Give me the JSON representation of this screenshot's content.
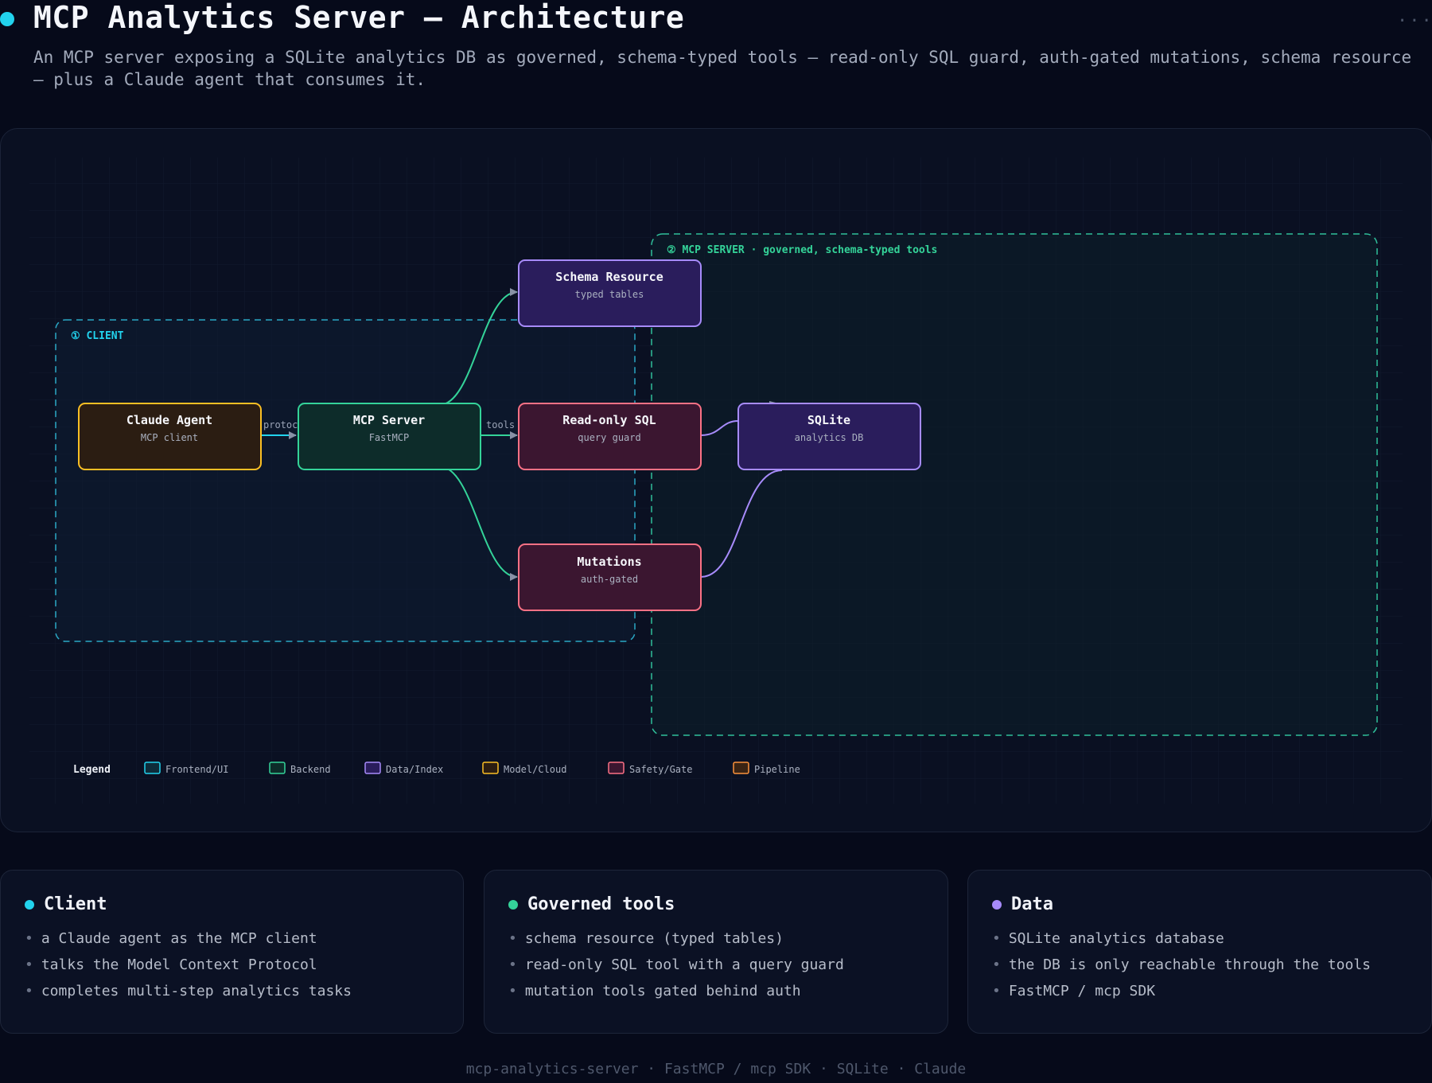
{
  "header": {
    "title": "MCP Analytics Server — Architecture",
    "subtitle": "An MCP server exposing a SQLite analytics DB as governed, schema-typed tools — read-only SQL guard, auth-gated mutations, schema resource — plus a Claude agent that consumes it.",
    "more_menu": "···"
  },
  "diagram": {
    "groups": {
      "client": "① CLIENT",
      "server": "② MCP SERVER · governed, schema-typed tools"
    },
    "nodes": {
      "agent": {
        "title": "Claude Agent",
        "sub": "MCP client"
      },
      "server": {
        "title": "MCP Server",
        "sub": "FastMCP"
      },
      "schema": {
        "title": "Schema Resource",
        "sub": "typed tables"
      },
      "sql": {
        "title": "Read-only SQL",
        "sub": "query guard"
      },
      "mutations": {
        "title": "Mutations",
        "sub": "auth-gated"
      },
      "sqlite": {
        "title": "SQLite",
        "sub": "analytics DB"
      }
    },
    "edge_labels": {
      "protocol": "protoc",
      "tools": "tools"
    },
    "legend": {
      "title": "Legend",
      "items": [
        "Frontend/UI",
        "Backend",
        "Data/Index",
        "Model/Cloud",
        "Safety/Gate",
        "Pipeline"
      ]
    }
  },
  "colors": {
    "frontend": "#22d3ee",
    "backend": "#34d399",
    "data": "#a78bfa",
    "model": "#fbbf24",
    "safety": "#fb7185",
    "pipeline": "#fb923c"
  },
  "cards": [
    {
      "title": "Client",
      "color": "#22d3ee",
      "items": [
        "a Claude agent as the MCP client",
        "talks the Model Context Protocol",
        "completes multi-step analytics tasks"
      ]
    },
    {
      "title": "Governed tools",
      "color": "#34d399",
      "items": [
        "schema resource (typed tables)",
        "read-only SQL tool with a query guard",
        "mutation tools gated behind auth"
      ]
    },
    {
      "title": "Data",
      "color": "#a78bfa",
      "items": [
        "SQLite analytics database",
        "the DB is only reachable through the tools",
        "FastMCP / mcp SDK"
      ]
    }
  ],
  "footer": "mcp-analytics-server · FastMCP / mcp SDK · SQLite · Claude"
}
